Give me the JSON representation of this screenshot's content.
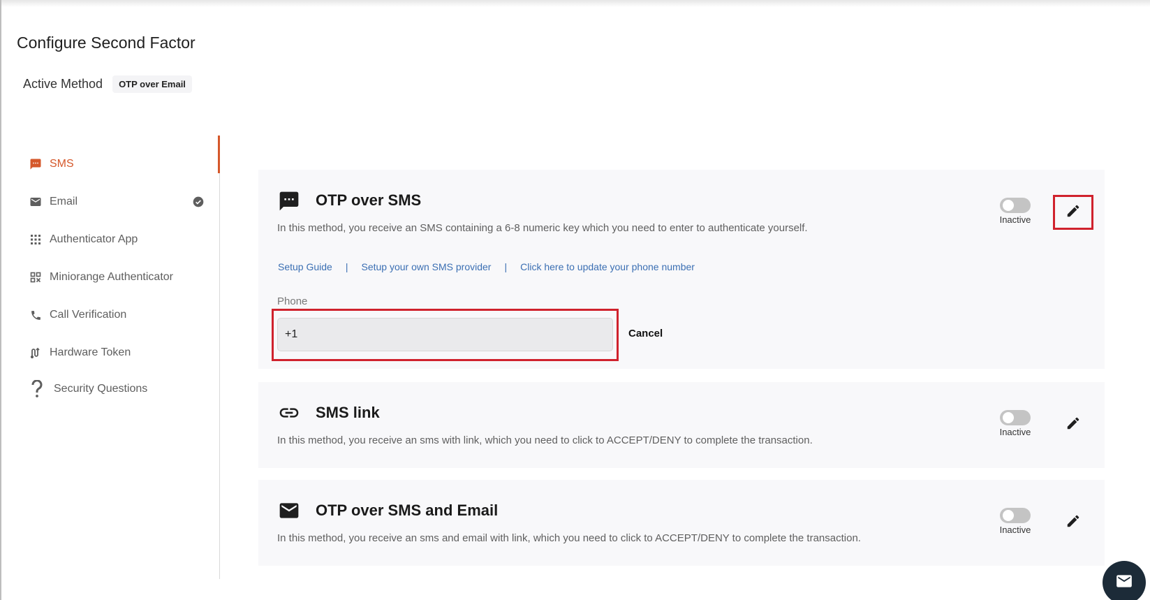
{
  "page": {
    "title": "Configure Second Factor",
    "active_method_label": "Active Method",
    "active_method_value": "OTP over Email"
  },
  "sidebar": {
    "items": [
      {
        "label": "SMS",
        "icon": "sms-icon",
        "active": true
      },
      {
        "label": "Email",
        "icon": "email-icon",
        "configured": true
      },
      {
        "label": "Authenticator App",
        "icon": "grid-icon"
      },
      {
        "label": "Miniorange Authenticator",
        "icon": "qr-code-icon"
      },
      {
        "label": "Call Verification",
        "icon": "phone-icon"
      },
      {
        "label": "Hardware Token",
        "icon": "hardware-token-icon"
      },
      {
        "label": "Security Questions",
        "icon": "question-mark-icon"
      }
    ]
  },
  "methods": [
    {
      "title": "OTP over SMS",
      "icon": "sms-icon",
      "description": "In this method, you receive an SMS containing a 6-8 numeric key which you need to enter to authenticate yourself.",
      "status": "Inactive",
      "links": [
        "Setup Guide",
        "Setup your own SMS provider",
        "Click here to update your phone number"
      ],
      "link_separator": "|",
      "phone_label": "Phone",
      "phone_value": "+1",
      "cancel_label": "Cancel"
    },
    {
      "title": "SMS link",
      "icon": "link-icon",
      "description": "In this method, you receive an sms with link, which you need to click to ACCEPT/DENY to complete the transaction.",
      "status": "Inactive"
    },
    {
      "title": "OTP over SMS and Email",
      "icon": "email-icon",
      "description": "In this method, you receive an sms and email with link, which you need to click to ACCEPT/DENY to complete the transaction.",
      "status": "Inactive"
    }
  ],
  "colors": {
    "accent": "#d5582b",
    "link": "#3b6fb3",
    "highlight_border": "#d0222d",
    "fab_bg": "#1c2b38"
  }
}
